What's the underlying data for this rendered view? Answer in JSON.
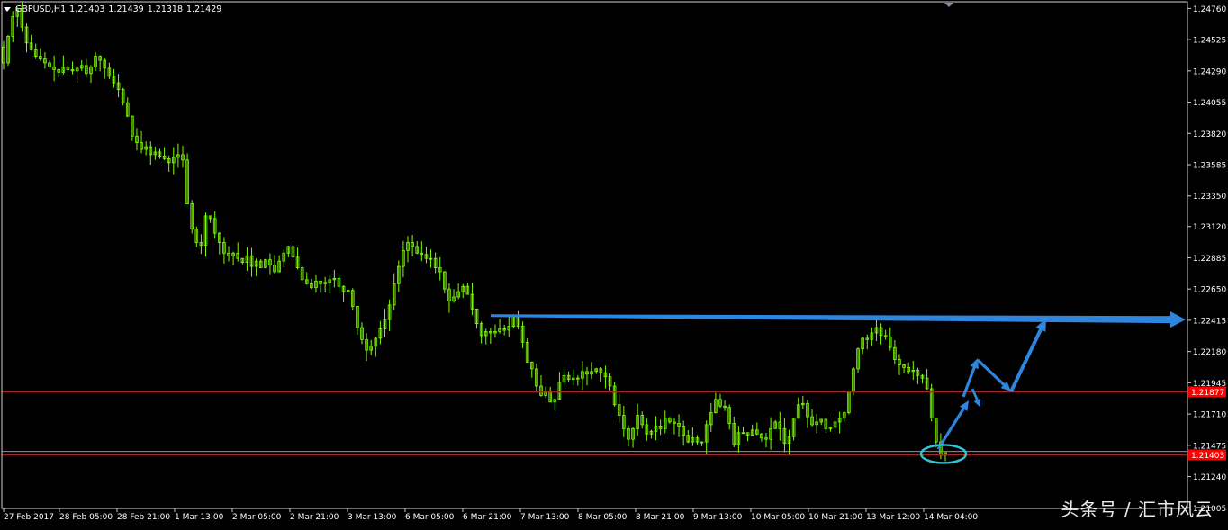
{
  "header": {
    "symbol": "GBPUSD,H1",
    "open": "1.21403",
    "high": "1.21439",
    "low": "1.21318",
    "close": "1.21429"
  },
  "price_axis": {
    "ticks": [
      "1.24760",
      "1.24525",
      "1.24290",
      "1.24055",
      "1.23820",
      "1.23585",
      "1.23350",
      "1.23120",
      "1.22885",
      "1.22650",
      "1.22415",
      "1.22180",
      "1.21945",
      "1.21710",
      "1.21475",
      "1.21240",
      "1.21005"
    ],
    "range": [
      1.21,
      1.2481
    ]
  },
  "time_axis": {
    "labels": [
      "27 Feb 2017",
      "28 Feb 05:00",
      "28 Feb 21:00",
      "1 Mar 13:00",
      "2 Mar 05:00",
      "2 Mar 21:00",
      "3 Mar 13:00",
      "6 Mar 05:00",
      "6 Mar 21:00",
      "7 Mar 13:00",
      "8 Mar 05:00",
      "8 Mar 21:00",
      "9 Mar 13:00",
      "10 Mar 05:00",
      "10 Mar 21:00",
      "13 Mar 12:00",
      "14 Mar 04:00"
    ]
  },
  "levels": [
    {
      "name": "support-high",
      "price": 1.21877,
      "label": "1.21877",
      "color": "#ff0000"
    },
    {
      "name": "support-low",
      "price": 1.21403,
      "label": "1.21403",
      "color": "#ff0000"
    }
  ],
  "bid_line": {
    "price": 1.21429,
    "color": "#8a8fc8"
  },
  "colors": {
    "background": "#000000",
    "candle": "#7fff00",
    "axis_text": "#ffffff",
    "arrow": "#2e86de",
    "ellipse": "#2ec8d8"
  },
  "watermark": "头条号 / 汇市风云",
  "chart_data": {
    "type": "line",
    "title": "",
    "series": [
      {
        "values": [
          1.2435,
          1.2455,
          1.247,
          1.2476,
          1.2462,
          1.245,
          1.2445,
          1.244,
          1.2438,
          1.2435,
          1.2432,
          1.243,
          1.2428,
          1.2432,
          1.243,
          1.2429,
          1.2431,
          1.2433,
          1.2427,
          1.2432,
          1.244,
          1.2437,
          1.2431,
          1.2425,
          1.242,
          1.2415,
          1.2405,
          1.2395,
          1.238,
          1.2375,
          1.237,
          1.2372,
          1.2366,
          1.2368,
          1.2365,
          1.2363,
          1.236,
          1.2364,
          1.2366,
          1.2362,
          1.2329,
          1.231,
          1.23,
          1.2298,
          1.232,
          1.2318,
          1.2307,
          1.23,
          1.2292,
          1.229,
          1.2292,
          1.2288,
          1.2285,
          1.229,
          1.2282,
          1.2286,
          1.2281,
          1.2287,
          1.2283,
          1.2278,
          1.2286,
          1.2292,
          1.2297,
          1.2289,
          1.2281,
          1.2272,
          1.2269,
          1.2266,
          1.2271,
          1.2269,
          1.227,
          1.2272,
          1.2273,
          1.2267,
          1.2263,
          1.2264,
          1.2252,
          1.2236,
          1.2227,
          1.2219,
          1.2222,
          1.2228,
          1.2235,
          1.2242,
          1.2253,
          1.2269,
          1.2282,
          1.2294,
          1.23,
          1.2297,
          1.2292,
          1.2291,
          1.2288,
          1.2288,
          1.2281,
          1.2278,
          1.2265,
          1.2256,
          1.2259,
          1.2263,
          1.2267,
          1.2261,
          1.225,
          1.2239,
          1.223,
          1.2233,
          1.2232,
          1.2233,
          1.2235,
          1.2234,
          1.2237,
          1.2244,
          1.2237,
          1.2225,
          1.221,
          1.2205,
          1.2192,
          1.2185,
          1.2188,
          1.218,
          1.2182,
          1.2195,
          1.22,
          1.2197,
          1.2198,
          1.2198,
          1.2203,
          1.2201,
          1.2203,
          1.2205,
          1.2202,
          1.2199,
          1.2192,
          1.2178,
          1.217,
          1.216,
          1.2152,
          1.216,
          1.217,
          1.2163,
          1.2156,
          1.2158,
          1.2162,
          1.216,
          1.2168,
          1.2165,
          1.2164,
          1.2162,
          1.2155,
          1.215,
          1.2153,
          1.215,
          1.215,
          1.2163,
          1.2172,
          1.2182,
          1.2177,
          1.2176,
          1.2164,
          1.2148,
          1.2157,
          1.2157,
          1.2155,
          1.2159,
          1.2156,
          1.2153,
          1.2152,
          1.216,
          1.2165,
          1.216,
          1.2149,
          1.2154,
          1.2168,
          1.2178,
          1.2179,
          1.2169,
          1.2163,
          1.2165,
          1.2167,
          1.216,
          1.2161,
          1.2165,
          1.2168,
          1.2172,
          1.2188,
          1.2205,
          1.222,
          1.2228,
          1.2227,
          1.2232,
          1.2236,
          1.223,
          1.2229,
          1.2221,
          1.2212,
          1.2208,
          1.2206,
          1.2203,
          1.2204,
          1.22,
          1.2198,
          1.219,
          1.2168,
          1.215,
          1.214,
          1.2142
        ]
      }
    ],
    "ylim": [
      1.21,
      1.2481
    ],
    "annotations": [
      {
        "type": "hline",
        "price": 1.21877,
        "label": "1.21877"
      },
      {
        "type": "hline",
        "price": 1.21403,
        "label": "1.21403"
      },
      {
        "type": "trendline",
        "from_price": 1.2245,
        "to_price": 1.2242
      },
      {
        "type": "path-arrows",
        "direction": "up"
      },
      {
        "type": "ellipse",
        "near_price": 1.2141
      }
    ]
  }
}
